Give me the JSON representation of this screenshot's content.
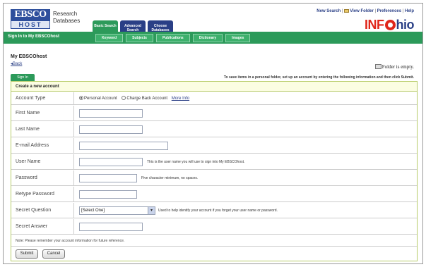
{
  "header": {
    "logo_main": "EBSCO",
    "logo_sub": "HOST",
    "logo_text": [
      "Research",
      "Databases"
    ],
    "tabs": [
      {
        "label": "Basic Search",
        "active": true
      },
      {
        "label": "Advanced Search",
        "active": false
      },
      {
        "label": "Choose Databases",
        "active": false
      }
    ],
    "toplinks": [
      "New Search",
      "View Folder",
      "Preferences",
      "Help"
    ],
    "brand": {
      "prefix": "INF",
      "suffix": "hio"
    },
    "signin_text": "Sign In to My EBSCOhost",
    "subnav": [
      "Keyword",
      "Subjects",
      "Publications",
      "Dictionary",
      "Images"
    ],
    "colors": {
      "green": "#2c9a5a",
      "navy": "#2a3f86",
      "brand_red": "#e0261a"
    }
  },
  "page": {
    "title": "My EBSCOhost",
    "back_link": "Back",
    "folder_status": "Folder is empty.",
    "signin_tab": "Sign In",
    "instructions": "To save items in a personal folder, set up an account by entering the following information and then click Submit."
  },
  "form": {
    "title": "Create a new account",
    "account_type": {
      "label": "Account Type",
      "options": [
        "Personal Account",
        "Charge Back Account"
      ],
      "selected": "Personal Account",
      "more_info": "More Info"
    },
    "fields": [
      {
        "label": "First Name",
        "value": "",
        "hint": ""
      },
      {
        "label": "Last Name",
        "value": "",
        "hint": ""
      },
      {
        "label": "E-mail Address",
        "value": "",
        "hint": ""
      },
      {
        "label": "User Name",
        "value": "",
        "hint": "This is the user name you will use to sign into My EBSCOhost."
      },
      {
        "label": "Password",
        "value": "",
        "hint": "Five character minimum, no spaces."
      },
      {
        "label": "Retype Password",
        "value": "",
        "hint": ""
      },
      {
        "label": "Secret Question",
        "value": "[Select One]",
        "hint": "Used to help identify your account if you forget your user name or password."
      },
      {
        "label": "Secret Answer",
        "value": "",
        "hint": ""
      }
    ],
    "note": "Note: Please remember your account information for future reference.",
    "submit_label": "Submit",
    "cancel_label": "Cancel"
  }
}
